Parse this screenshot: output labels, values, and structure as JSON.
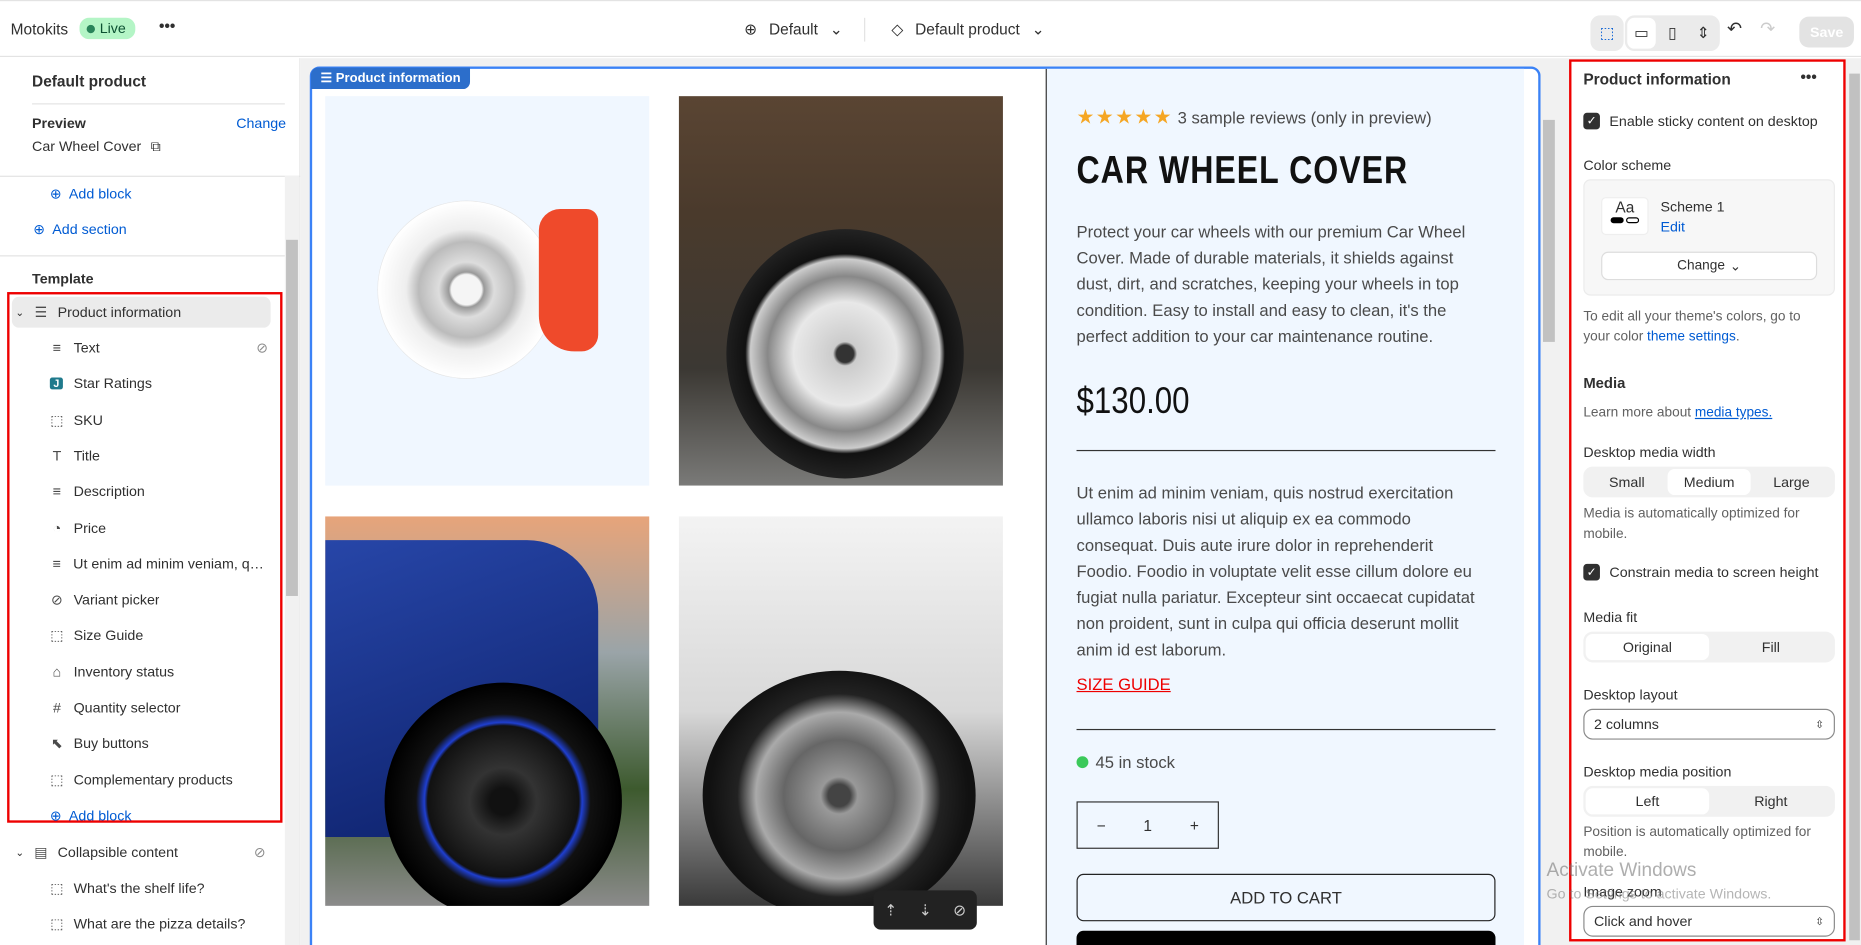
{
  "topbar": {
    "store": "Motokits",
    "status": "Live",
    "more": "•••",
    "theme": "Default",
    "template": "Default product",
    "save": "Save"
  },
  "sidebar": {
    "title": "Default product",
    "preview_label": "Preview",
    "preview_change": "Change",
    "preview_product": "Car Wheel Cover",
    "add_block": "Add block",
    "add_section": "Add section",
    "template_label": "Template",
    "section": "Product information",
    "blocks": [
      {
        "label": "Text",
        "icon": "text-icon",
        "glyph": "≡",
        "hidden": true
      },
      {
        "label": "Star Ratings",
        "icon": "app-icon",
        "glyph": "J"
      },
      {
        "label": "SKU",
        "icon": "dashed-square-icon",
        "glyph": "⬚"
      },
      {
        "label": "Title",
        "icon": "title-icon",
        "glyph": "T"
      },
      {
        "label": "Description",
        "icon": "text-icon",
        "glyph": "≡"
      },
      {
        "label": "Price",
        "icon": "price-tag-icon",
        "glyph": "◔"
      },
      {
        "label": "Ut enim ad minim veniam, qui...",
        "icon": "text-icon",
        "glyph": "≡"
      },
      {
        "label": "Variant picker",
        "icon": "variant-icon",
        "glyph": "⊘"
      },
      {
        "label": "Size Guide",
        "icon": "dashed-square-icon",
        "glyph": "⬚"
      },
      {
        "label": "Inventory status",
        "icon": "inventory-icon",
        "glyph": "⌂"
      },
      {
        "label": "Quantity selector",
        "icon": "hash-icon",
        "glyph": "#"
      },
      {
        "label": "Buy buttons",
        "icon": "cursor-icon",
        "glyph": "⬉"
      },
      {
        "label": "Complementary products",
        "icon": "dashed-square-icon",
        "glyph": "⬚"
      }
    ],
    "add_block_2": "Add block",
    "section2": "Collapsible content",
    "section2_blocks": [
      "What's the shelf life?",
      "What are the pizza details?"
    ]
  },
  "preview": {
    "tag": "Product information",
    "reviews": "3 sample reviews (only in preview)",
    "rating": 5,
    "title": "CAR WHEEL COVER",
    "description": "Protect your car wheels with our premium Car Wheel Cover. Made of durable materials, it shields against dust, dirt, and scratches, keeping your wheels in top condition. Easy to install and easy to clean, it's the perfect addition to your car maintenance routine.",
    "price": "$130.00",
    "lorem": "Ut enim ad minim veniam, quis nostrud exercitation ullamco laboris nisi ut aliquip ex ea commodo consequat. Duis aute irure dolor in reprehenderit Foodio. Foodio in voluptate velit esse cillum dolore eu fugiat nulla pariatur. Excepteur sint occaecat cupidatat non proident, sunt in culpa qui officia deserunt mollit anim id est laborum.",
    "size_guide": "SIZE GUIDE",
    "stock": "45 in stock",
    "qty": "1",
    "minus": "−",
    "plus": "+",
    "add_to_cart": "ADD TO CART"
  },
  "settings": {
    "title": "Product information",
    "more": "•••",
    "sticky": "Enable sticky content on desktop",
    "color_scheme": "Color scheme",
    "scheme_name": "Scheme 1",
    "scheme_edit": "Edit",
    "scheme_sample": "Aa",
    "change": "Change",
    "colors_note": "To edit all your theme's colors, go to your color ",
    "colors_link": "theme settings",
    "media": "Media",
    "media_note": "Learn more about ",
    "media_link": "media types.",
    "media_width": "Desktop media width",
    "width_options": [
      "Small",
      "Medium",
      "Large"
    ],
    "width_selected": "Medium",
    "width_note": "Media is automatically optimized for mobile.",
    "constrain": "Constrain media to screen height",
    "media_fit": "Media fit",
    "fit_options": [
      "Original",
      "Fill"
    ],
    "fit_selected": "Original",
    "layout": "Desktop layout",
    "layout_value": "2 columns",
    "position": "Desktop media position",
    "position_options": [
      "Left",
      "Right"
    ],
    "position_selected": "Left",
    "position_note": "Position is automatically optimized for mobile.",
    "zoom": "Image zoom",
    "zoom_value": "Click and hover"
  },
  "watermark": {
    "title": "Activate Windows",
    "sub": "Go to Settings to activate Windows."
  },
  "colors": {
    "accent": "#005bd3",
    "selection": "#e00000",
    "frame": "#3b82f6",
    "star": "#f5a623"
  }
}
